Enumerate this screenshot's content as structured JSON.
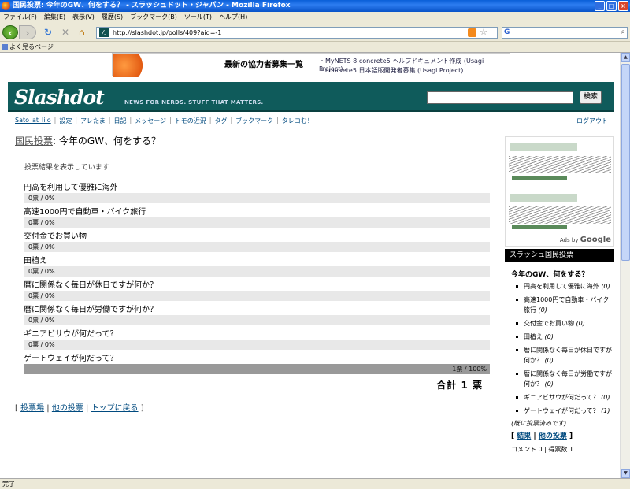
{
  "window": {
    "title": "国民投票: 今年のGW、何をする？ - スラッシュドット・ジャパン - Mozilla Firefox"
  },
  "menu": [
    "ファイル(F)",
    "編集(E)",
    "表示(V)",
    "履歴(S)",
    "ブックマーク(B)",
    "ツール(T)",
    "ヘルプ(H)"
  ],
  "address": "http://slashdot.jp/polls/409?aid=-1",
  "bookmarks": {
    "label": "よく見るページ"
  },
  "status": "完了",
  "banner": {
    "heading": "最新の協力者募集一覧",
    "line1": "・MyNETS 8 concrete5 ヘルプドキュメント作成 (Usagi Project)",
    "line2": "・concrete5 日本語版開発者募集 (Usagi Project)"
  },
  "header": {
    "logo": "Slashdot",
    "tagline": "NEWS FOR NERDS. STUFF THAT MATTERS.",
    "search_button": "検索"
  },
  "userbar": {
    "user": "Sato_at_lilo",
    "links": [
      "設定",
      "アレたま",
      "日記",
      "メッセージ",
      "トモの近況",
      "タグ",
      "ブックマーク",
      "タレコむ！"
    ],
    "logout": "ログアウト"
  },
  "poll": {
    "prefix": "国民投票",
    "title": ": 今年のGW、何をする？",
    "showing": "投票結果を表示しています",
    "options": [
      {
        "label": "円高を利用して優雅に海外",
        "result": "0票 / 0%",
        "percent": 0
      },
      {
        "label": "高速1000円で自動車・バイク旅行",
        "result": "0票 / 0%",
        "percent": 0
      },
      {
        "label": "交付金でお買い物",
        "result": "0票 / 0%",
        "percent": 0
      },
      {
        "label": "田植え",
        "result": "0票 / 0%",
        "percent": 0
      },
      {
        "label": "暦に関係なく毎日が休日ですが何か？",
        "result": "0票 / 0%",
        "percent": 0
      },
      {
        "label": "暦に関係なく毎日が労働ですが何か？",
        "result": "0票 / 0%",
        "percent": 0
      },
      {
        "label": "ギニアビサウが何だって？",
        "result": "0票 / 0%",
        "percent": 0
      },
      {
        "label": "ゲートウェイが何だって？",
        "result": "1票 / 100%",
        "percent": 100
      }
    ],
    "total": "合計 1 票",
    "links": {
      "vote": "投票場",
      "other": "他の投票",
      "top": "トップに戻る"
    }
  },
  "sidebar": {
    "ads_by": "Ads by",
    "google": "Google",
    "header": "スラッシュ国民投票",
    "title": "今年のGW、何をする？",
    "items": [
      {
        "label": "円高を利用して優雅に海外",
        "count": "(0)"
      },
      {
        "label": "高速1000円で自動車・バイク旅行",
        "count": "(0)"
      },
      {
        "label": "交付金でお買い物",
        "count": "(0)"
      },
      {
        "label": "田植え",
        "count": "(0)"
      },
      {
        "label": "暦に関係なく毎日が休日ですが何か？",
        "count": "(0)"
      },
      {
        "label": "暦に関係なく毎日が労働ですが何か？",
        "count": "(0)"
      },
      {
        "label": "ギニアビサウが何だって？",
        "count": "(0)"
      },
      {
        "label": "ゲートウェイが何だって？",
        "count": "(1)"
      }
    ],
    "voted": "(既に投票済みです)",
    "results": "結果",
    "other": "他の投票",
    "comments": "コメント 0 | 得票数 1"
  }
}
